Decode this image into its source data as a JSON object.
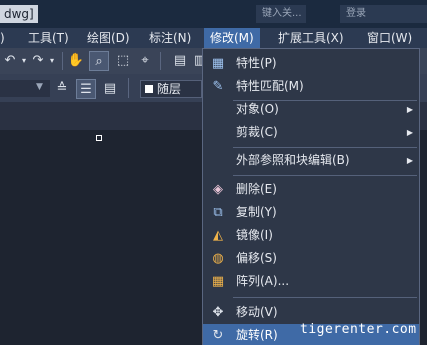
{
  "title": {
    "text": "dwg]",
    "search_placeholder": "键入关...",
    "login_text": "登录"
  },
  "menubar": {
    "items": [
      {
        "label": ")"
      },
      {
        "label": "工具(T)"
      },
      {
        "label": "绘图(D)"
      },
      {
        "label": "标注(N)"
      },
      {
        "label": "修改(M)",
        "active": true
      },
      {
        "label": "扩展工具(X)"
      },
      {
        "label": "窗口(W)"
      }
    ]
  },
  "toolbar": {
    "layer_name": "随层"
  },
  "modify_menu": {
    "items": [
      {
        "icon": "properties-icon",
        "glyph": "▦",
        "label": "特性(P)"
      },
      {
        "icon": "match-properties-icon",
        "glyph": "🖌",
        "label": "特性匹配(M)"
      },
      {
        "icon": "",
        "glyph": "",
        "label": "对象(O)",
        "submenu": true
      },
      {
        "icon": "",
        "glyph": "",
        "label": "剪裁(C)",
        "submenu": true
      },
      {
        "icon": "",
        "glyph": "",
        "label": "外部参照和块编辑(B)",
        "submenu": true
      },
      {
        "icon": "erase-icon",
        "glyph": "◈",
        "label": "删除(E)"
      },
      {
        "icon": "copy-icon",
        "glyph": "⧉",
        "label": "复制(Y)"
      },
      {
        "icon": "mirror-icon",
        "glyph": "◭",
        "label": "镜像(I)"
      },
      {
        "icon": "offset-icon",
        "glyph": "◍",
        "label": "偏移(S)"
      },
      {
        "icon": "array-icon",
        "glyph": "▦",
        "label": "阵列(A)..."
      },
      {
        "icon": "move-icon",
        "glyph": "✥",
        "label": "移动(V)"
      },
      {
        "icon": "rotate-icon",
        "glyph": "↻",
        "label": "旋转(R)",
        "hover": true
      }
    ]
  },
  "watermark": "tigerenter.com",
  "colors": {
    "accent": "#3f6aa6",
    "menu_bg": "#2e3748",
    "canvas_bg": "#1e2430"
  }
}
